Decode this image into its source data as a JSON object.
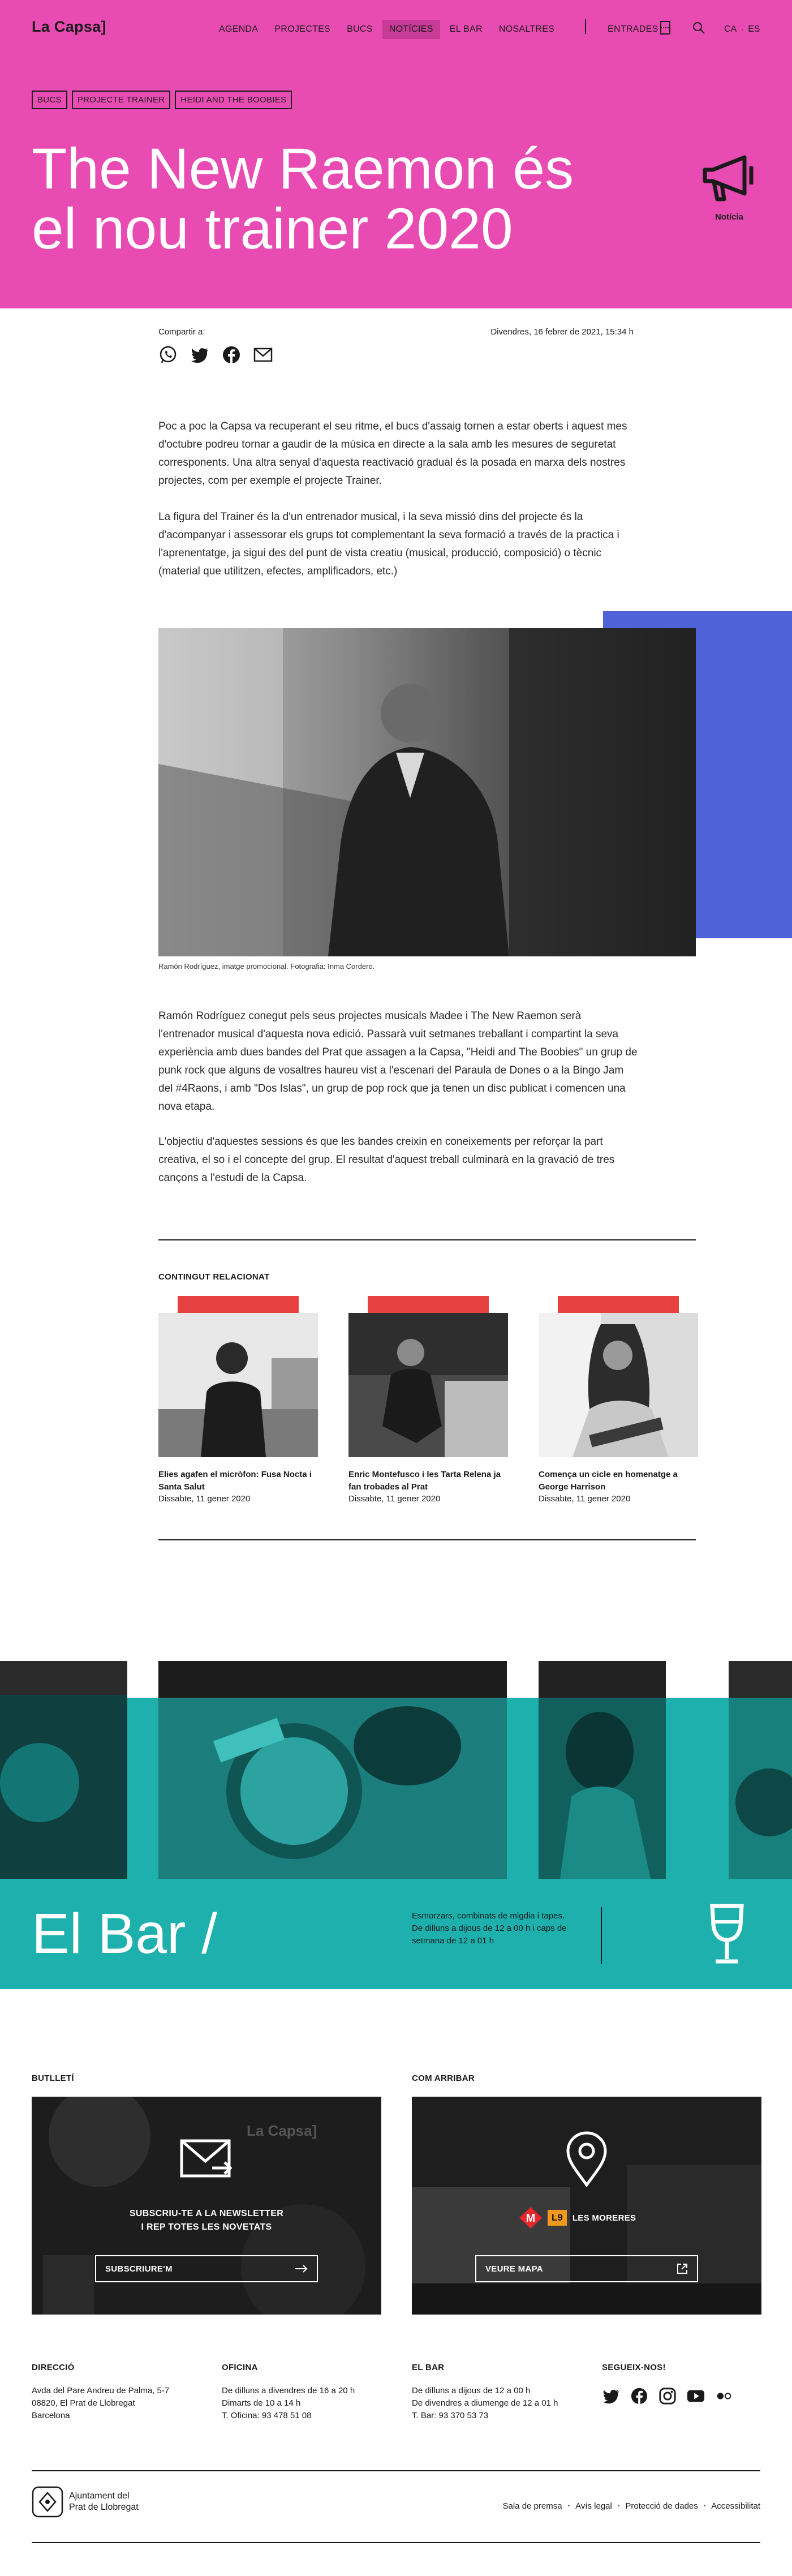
{
  "header": {
    "logo": "La Capsa]",
    "nav": [
      "AGENDA",
      "PROJECTES",
      "BUCS",
      "NOTÍCIES",
      "EL BAR",
      "NOSALTRES"
    ],
    "active_nav": 3,
    "tickets": "ENTRADES",
    "lang": [
      "CA",
      "ES"
    ]
  },
  "hero": {
    "tags": [
      "BUCS",
      "PROJECTE TRAINER",
      "HEIDI AND THE BOOBIES"
    ],
    "title": "The New Raemon és el nou trainer 2020",
    "type_label": "Notícia",
    "bg_color": "#e84bb2"
  },
  "article": {
    "share_label": "Compartir a:",
    "date": "Divendres, 16 febrer de 2021, 15:34 h",
    "p1": "Poc a poc la Capsa va recuperant el seu ritme, el bucs d'assaig tornen a estar oberts i aquest mes d'octubre podreu tornar a gaudir de la música en directe a la sala amb les mesures de seguretat corresponents. Una altra senyal d'aquesta reactivació gradual és la posada en marxa dels nostres projectes, com per exemple el projecte Trainer.",
    "p2": "La figura del Trainer és la d'un entrenador musical, i la seva missió dins del projecte és la d'acompanyar i assessorar els grups  tot complementant la seva formació a través de la practica i l'aprenentatge, ja sigui des del punt de vista creatiu (musical, producció, composició) o tècnic (material que utilitzen, efectes, amplificadors, etc.)",
    "caption": "Ramón Rodríguez, imatge promocional. Fotografia: Inma Cordero.",
    "p3": "Ramón Rodríguez conegut pels seus projectes musicals Madee i The New Raemon serà l'entrenador musical d'aquesta nova edició. Passarà vuit setmanes treballant i compartint la seva experiència amb dues bandes del Prat que assagen a la Capsa, \"Heidi and The Boobies\" un grup de punk rock que alguns de vosaltres haureu vist a l'escenari del Paraula de Dones o a la Bingo Jam del #4Raons, i amb \"Dos Islas\", un grup de pop rock que ja tenen un disc publicat i comencen una nova etapa.",
    "p4": "L'objectiu d'aquestes sessions és que les bandes creixin en coneixements per reforçar la part creativa, el so i el concepte del grup. El resultat d'aquest treball culminarà en la gravació de tres cançons a l'estudi de la Capsa."
  },
  "related": {
    "title": "CONTINGUT RELACIONAT",
    "items": [
      {
        "title": "Elies agafen el micròfon: Fusa Nocta i Santa Salut",
        "date": "Dissabte, 11 gener 2020"
      },
      {
        "title": "Enric Montefusco i les Tarta Relena ja fan trobades al Prat",
        "date": "Dissabte, 11 gener 2020"
      },
      {
        "title": "Comença un cicle en homenatge a George Harrison",
        "date": "Dissabte, 11 gener 2020"
      }
    ]
  },
  "bar": {
    "title": "El Bar /",
    "text": "Esmorzars, combinats de migdia i tapes. De dilluns a dijous de 12 a 00 h i caps de setmana de 12 a 01 h",
    "bg_color": "#1eb0ac"
  },
  "newsletter": {
    "title": "BUTLLETÍ",
    "label_line1": "SUBSCRIU-TE A LA NEWSLETTER",
    "label_line2": "I REP TOTES LES NOVETATS",
    "button": "SUBSCRIURE'M",
    "bg_text": "La Capsa]"
  },
  "directions": {
    "title": "COM ARRIBAR",
    "metro": "M",
    "line": "L9",
    "station": "LES MORERES",
    "button": "VEURE MAPA"
  },
  "footer": {
    "cols": [
      {
        "h": "DIRECCIÓ",
        "lines": [
          "Avda del Pare Andreu de Palma, 5-7",
          "08820, El Prat de Llobregat",
          "Barcelona"
        ]
      },
      {
        "h": "OFICINA",
        "lines": [
          "De dilluns a divendres de 16 a 20 h",
          "Dimarts de 10 a 14 h",
          "T. Oficina: 93 478 51 08"
        ]
      },
      {
        "h": "EL BAR",
        "lines": [
          "De dilluns a dijous de 12 a 00 h",
          "De divendres a diumenge de 12 a 01 h",
          "T. Bar: 93 370 53 73"
        ]
      }
    ],
    "social_title": "SEGUEIX-NOS!",
    "ajuntament_line1": "Ajuntament del",
    "ajuntament_line2": "Prat de Llobregat",
    "legal": [
      "Sala de premsa",
      "Avís legal",
      "Protecció de dades",
      "Accessibilitat"
    ]
  }
}
